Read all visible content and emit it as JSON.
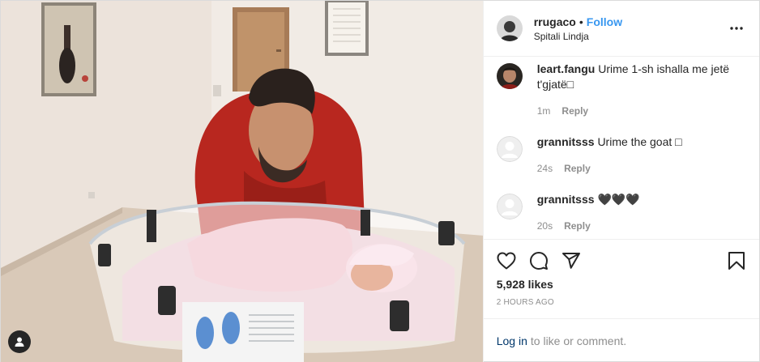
{
  "post": {
    "header": {
      "username": "rrugaco",
      "separator": "•",
      "follow_label": "Follow",
      "location": "Spitali Lindja",
      "more_icon": "more-horizontal-icon"
    },
    "comments": [
      {
        "username": "leart.fangu",
        "text": "Urime 1-sh ishalla me jetë t'gjatë□",
        "time": "1m",
        "reply_label": "Reply"
      },
      {
        "username": "grannitsss",
        "text": "Urime the goat □",
        "time": "24s",
        "reply_label": "Reply"
      },
      {
        "username": "grannitsss",
        "text": "🖤🖤🖤",
        "time": "20s",
        "reply_label": "Reply"
      }
    ],
    "likes": "5,928 likes",
    "timestamp": "2 HOURS AGO",
    "login": {
      "link_label": "Log in",
      "suffix": "to like or comment."
    },
    "icons": [
      "heart-icon",
      "comment-icon",
      "share-icon",
      "bookmark-icon",
      "user-tag-icon"
    ],
    "colors": {
      "follow": "#3897f0",
      "muted": "#8e8e8e",
      "text": "#262626",
      "link": "#00376b"
    }
  }
}
